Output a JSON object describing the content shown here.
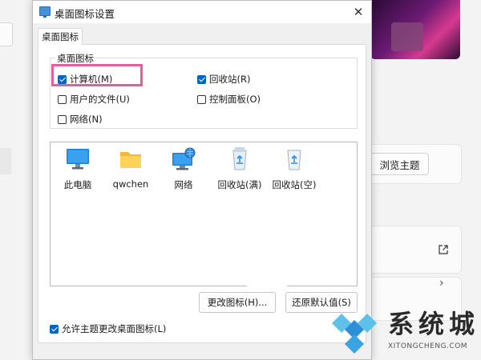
{
  "dialog": {
    "title": "桌面图标设置",
    "close_glyph": "✕",
    "tab_label": "桌面图标",
    "group_label": "桌面图标",
    "checkboxes": [
      {
        "label": "计算机(M)",
        "checked": true
      },
      {
        "label": "回收站(R)",
        "checked": true
      },
      {
        "label": "用户的文件(U)",
        "checked": false
      },
      {
        "label": "控制面板(O)",
        "checked": false
      },
      {
        "label": "网络(N)",
        "checked": false
      }
    ],
    "icons": [
      {
        "label": "此电脑",
        "icon": "monitor-icon"
      },
      {
        "label": "qwchen",
        "icon": "folder-icon"
      },
      {
        "label": "网络",
        "icon": "network-icon"
      },
      {
        "label": "回收站(满)",
        "icon": "recycle-bin-full-icon"
      },
      {
        "label": "回收站(空)",
        "icon": "recycle-bin-empty-icon"
      }
    ],
    "change_icon_label": "更改图标(H)...",
    "restore_default_label": "还原默认值(S)",
    "allow_theme_label": "允许主题更改桌面图标(L)",
    "allow_theme_checked": true,
    "highlight_color": "#e0609a",
    "accent_color": "#0067c0"
  },
  "background": {
    "browse_theme_label": "浏览主题",
    "external_link_icon": "external-link-icon",
    "chevron_icon": "chevron-right-icon",
    "chevron_glyph": "›"
  },
  "watermark": {
    "text": "系统城",
    "url": "XITONGCHENG.COM"
  }
}
